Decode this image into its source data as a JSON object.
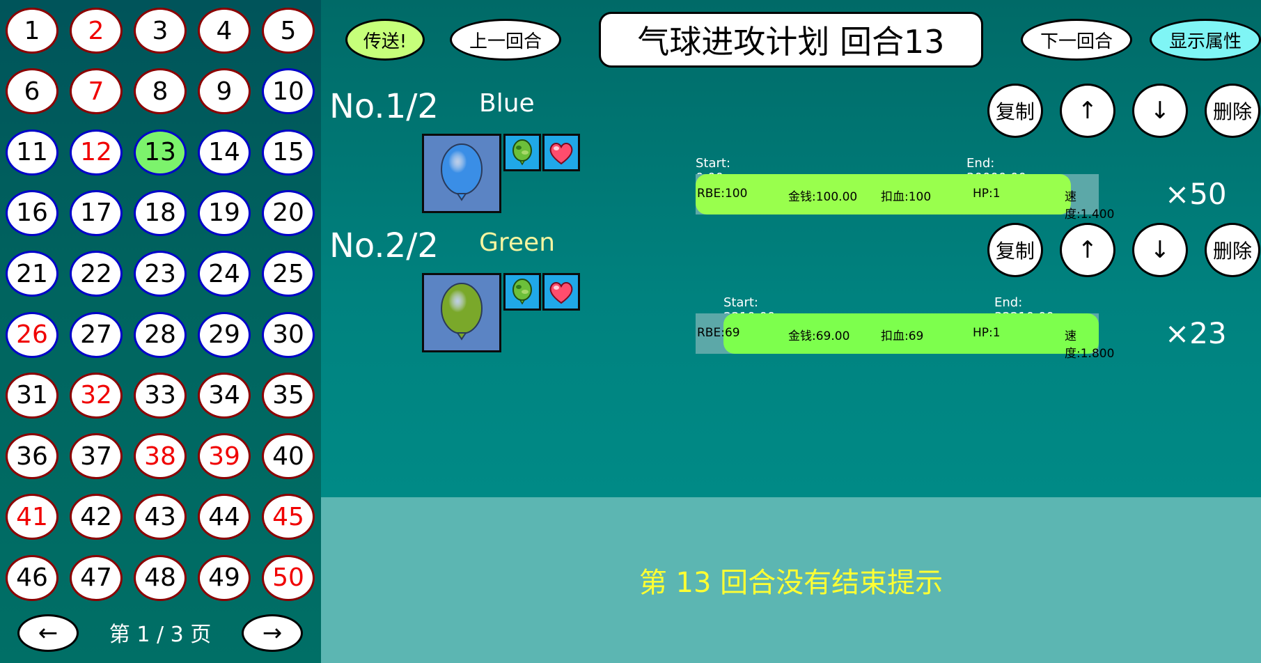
{
  "sidebar": {
    "rounds": [
      {
        "n": "1",
        "border": "red",
        "text": "black"
      },
      {
        "n": "2",
        "border": "red",
        "text": "red"
      },
      {
        "n": "3",
        "border": "red",
        "text": "black"
      },
      {
        "n": "4",
        "border": "red",
        "text": "black"
      },
      {
        "n": "5",
        "border": "red",
        "text": "black"
      },
      {
        "n": "6",
        "border": "red",
        "text": "black"
      },
      {
        "n": "7",
        "border": "red",
        "text": "red"
      },
      {
        "n": "8",
        "border": "red",
        "text": "black"
      },
      {
        "n": "9",
        "border": "red",
        "text": "black"
      },
      {
        "n": "10",
        "border": "blue",
        "text": "black"
      },
      {
        "n": "11",
        "border": "blue",
        "text": "black"
      },
      {
        "n": "12",
        "border": "blue",
        "text": "red"
      },
      {
        "n": "13",
        "border": "blue",
        "text": "black",
        "current": true
      },
      {
        "n": "14",
        "border": "blue",
        "text": "black"
      },
      {
        "n": "15",
        "border": "blue",
        "text": "black"
      },
      {
        "n": "16",
        "border": "blue",
        "text": "black"
      },
      {
        "n": "17",
        "border": "blue",
        "text": "black"
      },
      {
        "n": "18",
        "border": "blue",
        "text": "black"
      },
      {
        "n": "19",
        "border": "blue",
        "text": "black"
      },
      {
        "n": "20",
        "border": "blue",
        "text": "black"
      },
      {
        "n": "21",
        "border": "blue",
        "text": "black"
      },
      {
        "n": "22",
        "border": "blue",
        "text": "black"
      },
      {
        "n": "23",
        "border": "blue",
        "text": "black"
      },
      {
        "n": "24",
        "border": "blue",
        "text": "black"
      },
      {
        "n": "25",
        "border": "blue",
        "text": "black"
      },
      {
        "n": "26",
        "border": "blue",
        "text": "red"
      },
      {
        "n": "27",
        "border": "blue",
        "text": "black"
      },
      {
        "n": "28",
        "border": "blue",
        "text": "black"
      },
      {
        "n": "29",
        "border": "blue",
        "text": "black"
      },
      {
        "n": "30",
        "border": "blue",
        "text": "black"
      },
      {
        "n": "31",
        "border": "red",
        "text": "black"
      },
      {
        "n": "32",
        "border": "red",
        "text": "red"
      },
      {
        "n": "33",
        "border": "red",
        "text": "black"
      },
      {
        "n": "34",
        "border": "red",
        "text": "black"
      },
      {
        "n": "35",
        "border": "red",
        "text": "black"
      },
      {
        "n": "36",
        "border": "red",
        "text": "black"
      },
      {
        "n": "37",
        "border": "red",
        "text": "black"
      },
      {
        "n": "38",
        "border": "red",
        "text": "red"
      },
      {
        "n": "39",
        "border": "red",
        "text": "red"
      },
      {
        "n": "40",
        "border": "red",
        "text": "black"
      },
      {
        "n": "41",
        "border": "red",
        "text": "red"
      },
      {
        "n": "42",
        "border": "red",
        "text": "black"
      },
      {
        "n": "43",
        "border": "red",
        "text": "black"
      },
      {
        "n": "44",
        "border": "red",
        "text": "black"
      },
      {
        "n": "45",
        "border": "red",
        "text": "red"
      },
      {
        "n": "46",
        "border": "red",
        "text": "black"
      },
      {
        "n": "47",
        "border": "red",
        "text": "black"
      },
      {
        "n": "48",
        "border": "red",
        "text": "black"
      },
      {
        "n": "49",
        "border": "red",
        "text": "black"
      },
      {
        "n": "50",
        "border": "red",
        "text": "red"
      }
    ],
    "prev_page": "←",
    "next_page": "→",
    "page_label": "第 1 / 3 页"
  },
  "header": {
    "send_label": "传送!",
    "prev_round_label": "上一回合",
    "title": "气球进攻计划 回合13",
    "next_round_label": "下一回合",
    "show_props_label": "显示属性"
  },
  "entries": [
    {
      "no": "No.1/2",
      "name": "Blue",
      "name_color": "#ffffff",
      "balloon_color": "#3a8ee6",
      "actions": {
        "copy": "复制",
        "up": "↑",
        "down": "↓",
        "delete": "删除"
      },
      "start_label": "Start: 0.00ms",
      "end_label": "End: 30000.00ms",
      "bar_color": "#99ff4d",
      "bar_start_fraction": 0.0,
      "bar_end_fraction": 0.931,
      "stats": {
        "rbe": "RBE:100",
        "money": "金钱:100.00",
        "damage": "扣血:100",
        "hp": "HP:1",
        "speed": "速度:1.400"
      },
      "count": "×50",
      "icons": [
        "balloon-icon",
        "camo-icon",
        "heart-icon"
      ]
    },
    {
      "no": "No.2/2",
      "name": "Green",
      "name_color": "#f5f5a0",
      "balloon_color": "#7aa82a",
      "actions": {
        "copy": "复制",
        "up": "↑",
        "down": "↓",
        "delete": "删除"
      },
      "start_label": "Start: 2210.00ms",
      "end_label": "End: 32210.00ms",
      "bar_color": "#7dff4d",
      "bar_start_fraction": 0.069,
      "bar_end_fraction": 1.0,
      "stats": {
        "rbe": "RBE:69",
        "money": "金钱:69.00",
        "damage": "扣血:69",
        "hp": "HP:1",
        "speed": "速度:1.800"
      },
      "count": "×23",
      "icons": [
        "balloon-icon",
        "camo-icon",
        "heart-icon"
      ]
    }
  ],
  "hint": "第  13  回合没有结束提示",
  "colors": {
    "current_round": "#7cf36c",
    "send_button": "#c6ff7a",
    "show_props_button": "#7ff5f5",
    "hint_text": "#ffff33"
  }
}
